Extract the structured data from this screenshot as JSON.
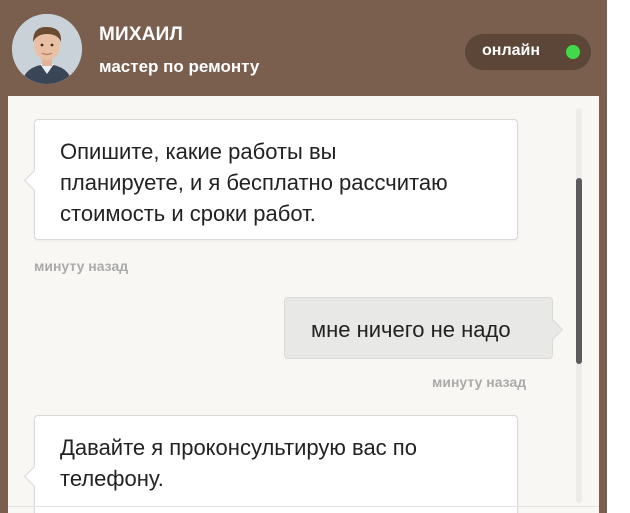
{
  "agent": {
    "name": "МИХАИЛ",
    "role": "мастер по ремонту",
    "status": "онлайн",
    "status_color": "#41d84a"
  },
  "messages": [
    {
      "direction": "incoming",
      "lines": [
        "Опишите, какие работы вы",
        "планируете, и я бесплатно рассчитаю",
        "стоимость и сроки работ."
      ],
      "time": "минуту назад"
    },
    {
      "direction": "outgoing",
      "lines": [
        "мне ничего не надо"
      ],
      "time": "минуту назад"
    },
    {
      "direction": "incoming",
      "lines": [
        "Давайте я проконсультирую вас по",
        "телефону."
      ],
      "time": ""
    }
  ],
  "colors": {
    "header_bg": "#7a5e4e",
    "chat_bg": "#f9f7f4",
    "outgoing_bubble": "#e8e8e6"
  }
}
